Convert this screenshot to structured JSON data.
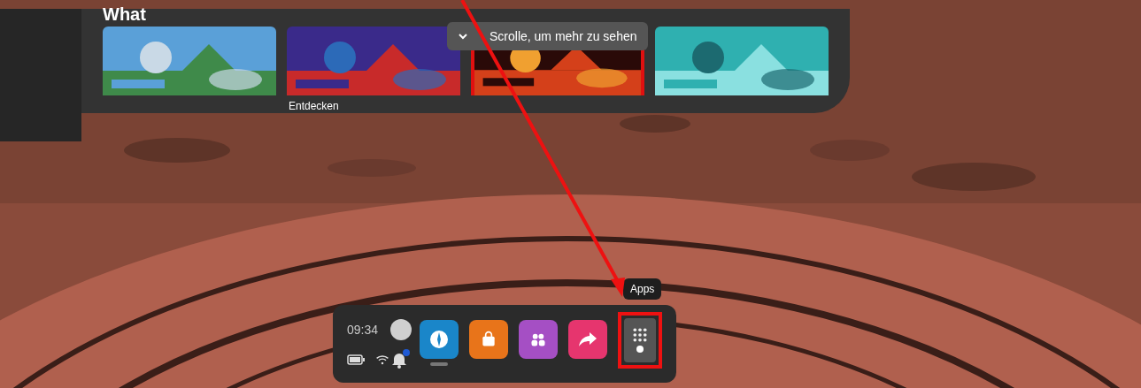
{
  "panel": {
    "title": "What",
    "tiles": [
      {
        "kind": "picture",
        "selected": false
      },
      {
        "kind": "picture",
        "selected": false
      },
      {
        "kind": "picture",
        "selected": true
      },
      {
        "kind": "picture",
        "selected": false
      }
    ],
    "scroll_hint": "Scrolle, um mehr zu sehen",
    "section_label": "Entdecken"
  },
  "taskbar": {
    "time": "09:34",
    "notification_badge": true,
    "apps": [
      {
        "kind": "compass",
        "color": "#1a86c9",
        "selected": true
      },
      {
        "kind": "store",
        "color": "#e8741a",
        "selected": false
      },
      {
        "kind": "people",
        "color": "#a54fc4",
        "selected": false
      },
      {
        "kind": "share",
        "color": "#e6356e",
        "selected": false
      }
    ],
    "apps_button": {
      "tooltip": "Apps",
      "highlighted": true
    }
  }
}
